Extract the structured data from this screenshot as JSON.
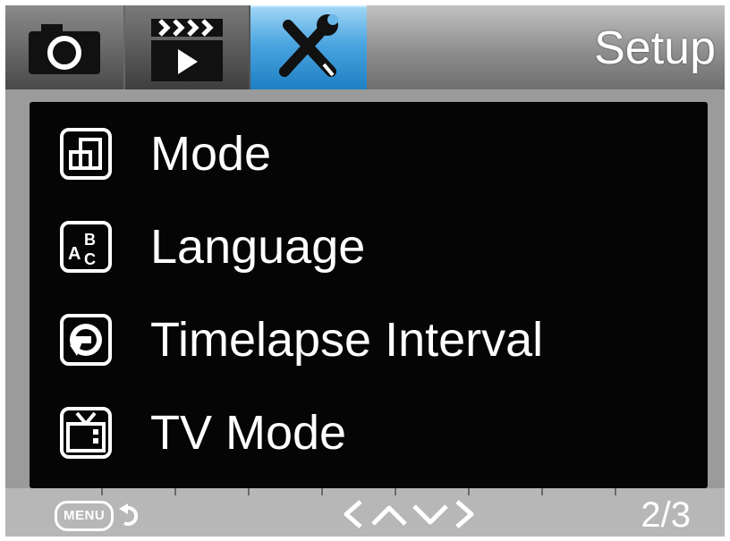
{
  "header": {
    "title": "Setup",
    "tabs": [
      {
        "id": "photo",
        "icon": "camera-icon",
        "active": false
      },
      {
        "id": "video",
        "icon": "clapperboard-icon",
        "active": false
      },
      {
        "id": "setup",
        "icon": "wrench-screwdriver-icon",
        "active": true
      }
    ],
    "active_tab_color": "#2a8fd4"
  },
  "menu": {
    "items": [
      {
        "label": "Mode",
        "icon": "mode-icon"
      },
      {
        "label": "Language",
        "icon": "language-icon"
      },
      {
        "label": "Timelapse Interval",
        "icon": "timelapse-icon"
      },
      {
        "label": "TV Mode",
        "icon": "tv-icon"
      }
    ]
  },
  "footer": {
    "menu_label": "MENU",
    "back_icon": "back-arrow-icon",
    "nav_icons": [
      "left-arrow-icon",
      "up-arrow-icon",
      "down-arrow-icon",
      "right-arrow-icon"
    ],
    "page": "2/3"
  }
}
